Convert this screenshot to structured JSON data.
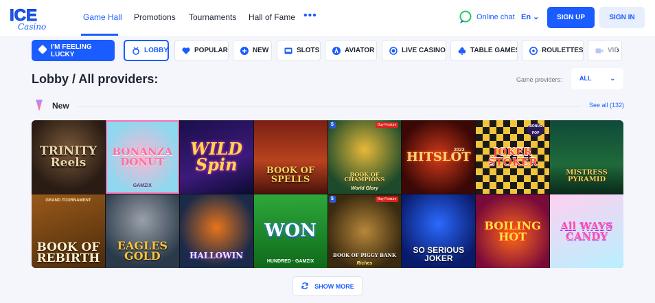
{
  "header": {
    "logo_top": "ICE",
    "logo_bottom": "Casino",
    "nav": [
      "Game Hall",
      "Promotions",
      "Tournaments",
      "Hall of Fame"
    ],
    "more": "•••",
    "chat_label": "Online chat",
    "lang": "En",
    "signup": "SIGN UP",
    "signin": "SIGN IN"
  },
  "categories": {
    "lucky": "I'M FEELING LUCKY",
    "items": [
      "LOBBY",
      "POPULAR",
      "NEW",
      "SLOTS",
      "AVIATOR",
      "LIVE CASINO",
      "TABLE GAMES",
      "ROULETTES",
      "VID"
    ]
  },
  "page": {
    "title": "Lobby / All providers:",
    "providers_label": "Game providers:",
    "providers_value": "ALL"
  },
  "section": {
    "title": "New",
    "see_all": "See all (132)"
  },
  "games": [
    {
      "name": "TRINITY\nReels",
      "sub": ""
    },
    {
      "name": "BONANZA\nDONUT",
      "sub": "GAMZIX"
    },
    {
      "name": "WILD\nSpin",
      "sub": ""
    },
    {
      "name": "BOOK OF SPELLS",
      "sub": ""
    },
    {
      "name": "BOOK OF CHAMPIONS",
      "sub": "World Glory"
    },
    {
      "name": "HITSLOT",
      "sub": "2022"
    },
    {
      "name": "JOKER\nSTOKER",
      "sub": "BONUS POP"
    },
    {
      "name": "MISTRESS\nPYRAMID",
      "sub": ""
    },
    {
      "name": "BOOK OF\nREBIRTH",
      "sub": "GRAND TOURNAMENT"
    },
    {
      "name": "EAGLES\nGOLD",
      "sub": ""
    },
    {
      "name": "HALLOWIN",
      "sub": ""
    },
    {
      "name": "WON",
      "sub": "HUNDRED · GAMZIX"
    },
    {
      "name": "BOOK OF PIGGY BANK",
      "sub": "Riches"
    },
    {
      "name": "SO SERIOUS\nJOKER",
      "sub": ""
    },
    {
      "name": "BOILING\nHOT",
      "sub": ""
    },
    {
      "name": "All WAYS\nCANDY",
      "sub": ""
    }
  ],
  "tile_badges": {
    "five": "5",
    "buy": "Buy Feature"
  },
  "show_more": "SHOW MORE",
  "colors": {
    "accent": "#1a5cff",
    "background": "#f4f6fb"
  }
}
